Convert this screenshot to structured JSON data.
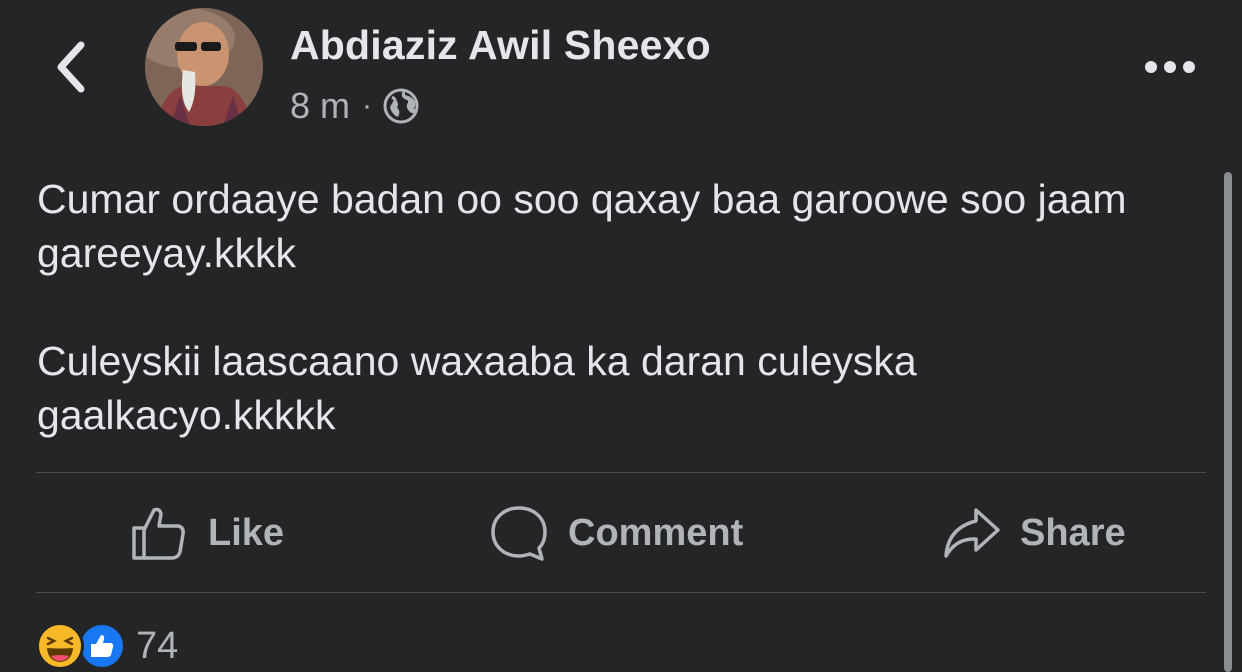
{
  "header": {
    "author_name": "Abdiaziz Awil Sheexo",
    "timestamp": "8 m",
    "separator": "·",
    "privacy_icon": "globe-icon",
    "back_icon": "chevron-left-icon",
    "more_icon": "more-horizontal-icon"
  },
  "post": {
    "paragraphs": [
      "Cumar ordaaye badan oo soo qaxay baa garoowe soo jaam gareeyay.kkkk",
      "Culeyskii laascaano waxaaba ka daran culeyska gaalkacyo.kkkkk"
    ]
  },
  "actions": {
    "like_label": "Like",
    "comment_label": "Comment",
    "share_label": "Share"
  },
  "reactions": {
    "icons": [
      "laughing-emoji-icon",
      "thumbs-up-icon"
    ],
    "count": "74"
  },
  "colors": {
    "background": "#242526",
    "text_primary": "#e4e6eb",
    "text_secondary": "#b0b3b8",
    "like_blue": "#1877f2",
    "haha_yellow": "#f7b928"
  }
}
